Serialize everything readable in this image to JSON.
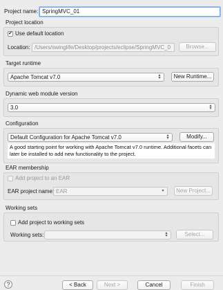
{
  "project_name": {
    "label": "Project name:",
    "value": "SpringMVC_01"
  },
  "project_location": {
    "title": "Project location",
    "use_default_label": "Use default location",
    "use_default_checked": true,
    "location_label": "Location:",
    "location_value": "/Users/swinglife/Desktop/projects/eclipse/SpringMVC_0",
    "browse_label": "Browse..."
  },
  "target_runtime": {
    "title": "Target runtime",
    "selected": "Apache Tomcat v7.0",
    "new_runtime_label": "New Runtime..."
  },
  "web_module": {
    "title": "Dynamic web module version",
    "selected": "3.0"
  },
  "configuration": {
    "title": "Configuration",
    "selected": "Default Configuration for Apache Tomcat v7.0",
    "modify_label": "Modify...",
    "description": "A good starting point for working with Apache Tomcat v7.0 runtime. Additional facets can later be installed to add new functionality to the project."
  },
  "ear_membership": {
    "title": "EAR membership",
    "add_label": "Add project to an EAR",
    "ear_project_label": "EAR project name:",
    "ear_project_value": "EAR",
    "new_project_label": "New Project..."
  },
  "working_sets": {
    "title": "Working sets",
    "add_label": "Add project to working sets",
    "sets_label": "Working sets:",
    "sets_value": "",
    "select_label": "Select..."
  },
  "footer": {
    "help_icon": "question-mark",
    "back_label": "< Back",
    "next_label": "Next >",
    "cancel_label": "Cancel",
    "finish_label": "Finish"
  }
}
